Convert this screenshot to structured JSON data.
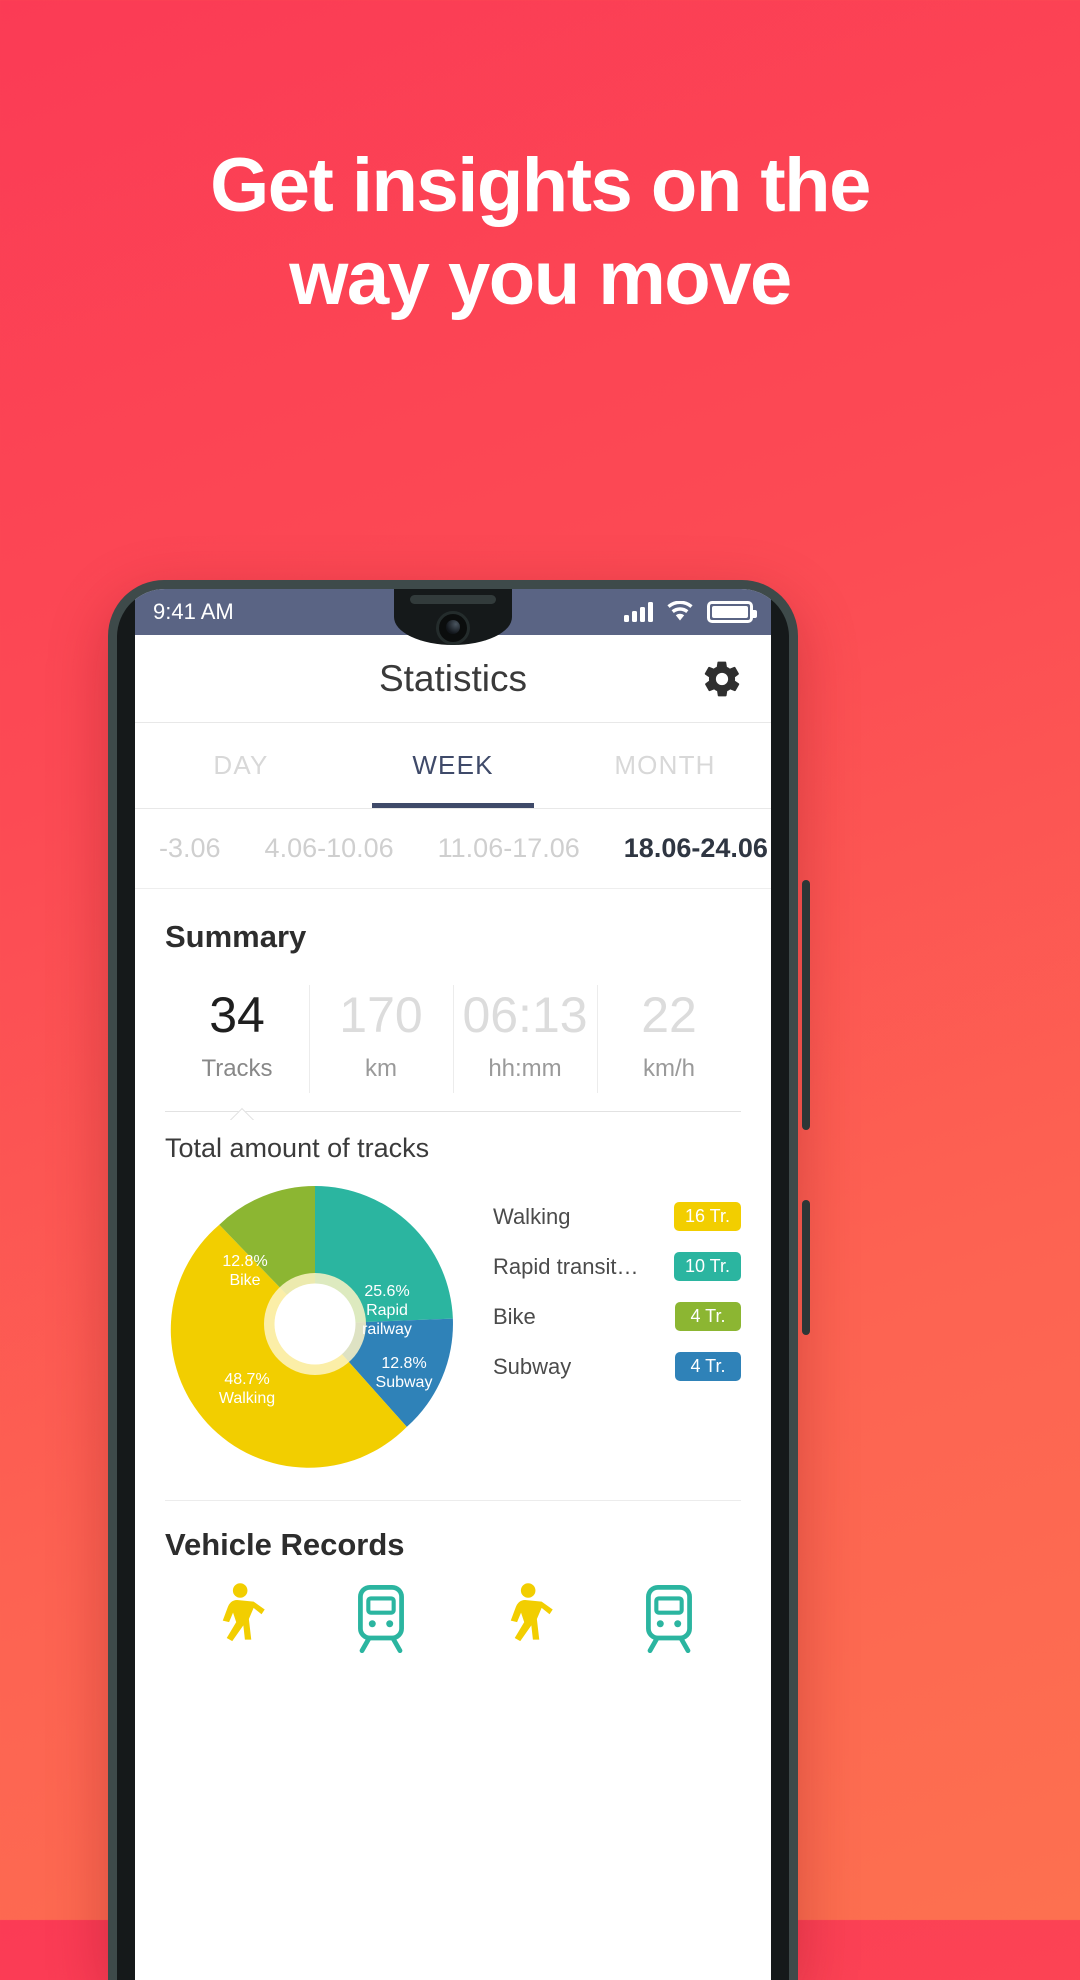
{
  "promo": {
    "headline_line1": "Get insights on the",
    "headline_line2": "way you move",
    "bg_start": "#fb3b55",
    "bg_end": "#fd7050"
  },
  "statusbar": {
    "time": "9:41 AM",
    "signal_icon": "signal-bars-icon",
    "wifi_icon": "wifi-icon",
    "battery_icon": "battery-full-icon",
    "bg_color": "#5a6484"
  },
  "appbar": {
    "title": "Statistics",
    "settings_icon": "gear-icon"
  },
  "tabs": [
    {
      "label": "DAY",
      "active": false
    },
    {
      "label": "WEEK",
      "active": true
    },
    {
      "label": "MONTH",
      "active": false
    }
  ],
  "weeks": [
    {
      "label": "-3.06",
      "active": false
    },
    {
      "label": "4.06-10.06",
      "active": false
    },
    {
      "label": "11.06-17.06",
      "active": false
    },
    {
      "label": "18.06-24.06",
      "active": true
    }
  ],
  "summary": {
    "title": "Summary",
    "stats": [
      {
        "value": "34",
        "label": "Tracks",
        "active": true
      },
      {
        "value": "170",
        "label": "km",
        "active": false
      },
      {
        "value": "06:13",
        "label": "hh:mm",
        "active": false
      },
      {
        "value": "22",
        "label": "km/h",
        "active": false
      }
    ]
  },
  "chart_data": {
    "type": "pie",
    "title": "Total amount of tracks",
    "categories": [
      "Walking",
      "Rapid railway",
      "Bike",
      "Subway"
    ],
    "values": [
      48.7,
      25.6,
      12.8,
      12.8
    ],
    "counts": [
      16,
      10,
      4,
      4
    ],
    "colors": [
      "#f2ce00",
      "#2bb5a0",
      "#8cb632",
      "#2f82b8"
    ],
    "slice_labels": [
      "48.7%\nWalking",
      "25.6%\nRapid\nrailway",
      "12.8%\nBike",
      "12.8%\nSubway"
    ],
    "legend_position": "right",
    "legend": [
      {
        "name": "Walking",
        "badge": "16 Tr.",
        "color": "#f2ce00"
      },
      {
        "name": "Rapid transit…",
        "badge": "10 Tr.",
        "color": "#2bb5a0"
      },
      {
        "name": "Bike",
        "badge": "4 Tr.",
        "color": "#8cb632"
      },
      {
        "name": "Subway",
        "badge": "4 Tr.",
        "color": "#2f82b8"
      }
    ]
  },
  "vehicle_records": {
    "title": "Vehicle Records",
    "icons": [
      {
        "name": "walking-icon",
        "color": "#f2ce00"
      },
      {
        "name": "train-icon",
        "color": "#2bb5a0"
      },
      {
        "name": "walking-icon",
        "color": "#f2ce00"
      },
      {
        "name": "train-icon",
        "color": "#2bb5a0"
      }
    ]
  }
}
